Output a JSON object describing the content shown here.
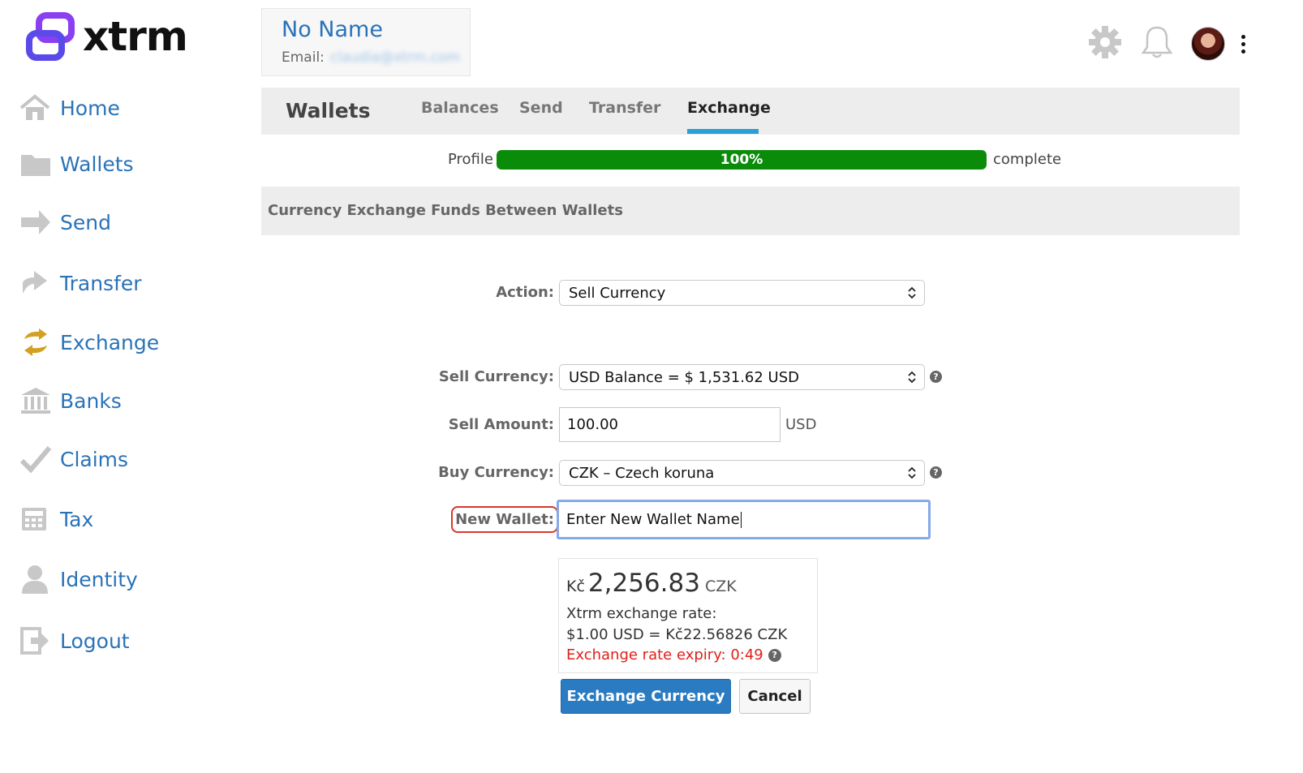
{
  "brand": {
    "name": "xtrm",
    "accent": "#7b3fe4"
  },
  "sidebar": {
    "items": [
      {
        "label": "Home",
        "icon": "home-icon"
      },
      {
        "label": "Wallets",
        "icon": "folder-icon"
      },
      {
        "label": "Send",
        "icon": "arrow-right-icon"
      },
      {
        "label": "Transfer",
        "icon": "transfer-arrow-icon"
      },
      {
        "label": "Exchange",
        "icon": "exchange-arrows-icon"
      },
      {
        "label": "Banks",
        "icon": "bank-icon"
      },
      {
        "label": "Claims",
        "icon": "checkmark-icon"
      },
      {
        "label": "Tax",
        "icon": "calculator-icon"
      },
      {
        "label": "Identity",
        "icon": "user-icon"
      },
      {
        "label": "Logout",
        "icon": "logout-icon"
      }
    ]
  },
  "profile": {
    "name": "No Name",
    "email_label": "Email:",
    "email_value": "claudia@xtrm.com"
  },
  "header": {
    "section_title": "Wallets",
    "tabs": [
      {
        "label": "Balances"
      },
      {
        "label": "Send"
      },
      {
        "label": "Transfer"
      },
      {
        "label": "Exchange",
        "active": true
      }
    ]
  },
  "progress": {
    "label": "Profile",
    "value_percent": 100,
    "value_text": "100%",
    "suffix": "complete",
    "color": "#0a8c0a"
  },
  "section": {
    "title": "Currency Exchange Funds Between Wallets"
  },
  "form": {
    "action_label": "Action:",
    "action_value": "Sell Currency",
    "sell_currency_label": "Sell Currency:",
    "sell_currency_value": "USD Balance = $ 1,531.62 USD",
    "sell_amount_label": "Sell Amount:",
    "sell_amount_value": "100.00",
    "sell_amount_unit": "USD",
    "buy_currency_label": "Buy Currency:",
    "buy_currency_value": "CZK – Czech koruna",
    "new_wallet_label": "New Wallet:",
    "new_wallet_value": "Enter New Wallet Name",
    "help_glyph": "?"
  },
  "result": {
    "symbol": "Kč",
    "amount": "2,256.83",
    "code": "CZK",
    "rate_label": "Xtrm exchange rate:",
    "rate_value": "$1.00 USD = Kč22.56826 CZK",
    "expiry": "Exchange rate expiry: 0:49",
    "expiry_color": "#e0201a"
  },
  "buttons": {
    "submit": "Exchange Currency",
    "cancel": "Cancel"
  }
}
